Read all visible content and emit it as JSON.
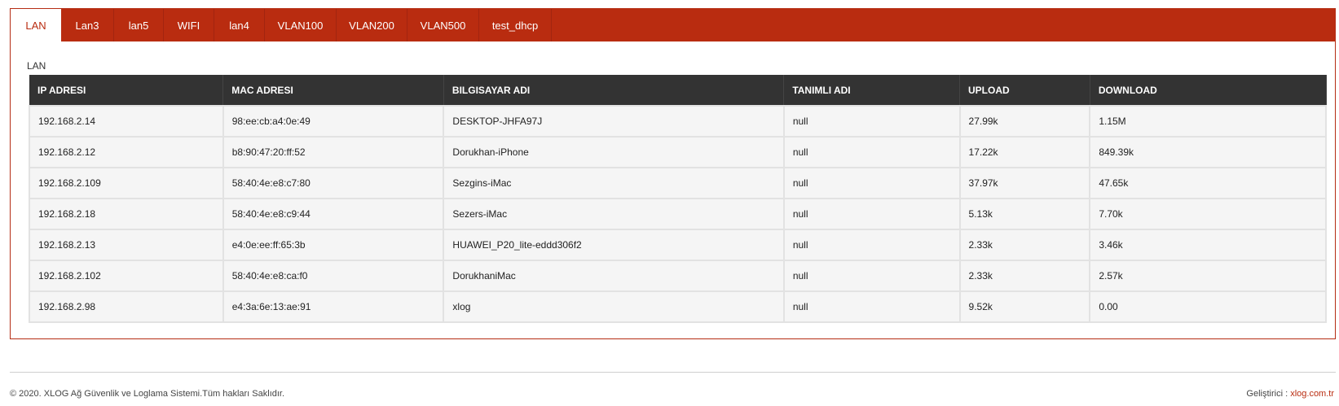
{
  "tabs": [
    {
      "label": "LAN",
      "active": true
    },
    {
      "label": "Lan3"
    },
    {
      "label": "lan5"
    },
    {
      "label": "WIFI"
    },
    {
      "label": "lan4"
    },
    {
      "label": "VLAN100"
    },
    {
      "label": "VLAN200"
    },
    {
      "label": "VLAN500"
    },
    {
      "label": "test_dhcp"
    }
  ],
  "section": {
    "label": "LAN"
  },
  "table": {
    "headers": [
      "IP ADRESI",
      "MAC ADRESI",
      "BILGISAYAR ADI",
      "TANIMLI ADI",
      "UPLOAD",
      "DOWNLOAD"
    ],
    "rows": [
      [
        "192.168.2.14",
        "98:ee:cb:a4:0e:49",
        "DESKTOP-JHFA97J",
        "null",
        "27.99k",
        "1.15M"
      ],
      [
        "192.168.2.12",
        "b8:90:47:20:ff:52",
        "Dorukhan-iPhone",
        "null",
        "17.22k",
        "849.39k"
      ],
      [
        "192.168.2.109",
        "58:40:4e:e8:c7:80",
        "Sezgins-iMac",
        "null",
        "37.97k",
        "47.65k"
      ],
      [
        "192.168.2.18",
        "58:40:4e:e8:c9:44",
        "Sezers-iMac",
        "null",
        "5.13k",
        "7.70k"
      ],
      [
        "192.168.2.13",
        "e4:0e:ee:ff:65:3b",
        "HUAWEI_P20_lite-eddd306f2",
        "null",
        "2.33k",
        "3.46k"
      ],
      [
        "192.168.2.102",
        "58:40:4e:e8:ca:f0",
        "DorukhaniMac",
        "null",
        "2.33k",
        "2.57k"
      ],
      [
        "192.168.2.98",
        "e4:3a:6e:13:ae:91",
        "xlog",
        "null",
        "9.52k",
        "0.00"
      ]
    ]
  },
  "footer": {
    "copyright": "© 2020. XLOG Ağ Güvenlik ve Loglama Sistemi.Tüm hakları Saklıdır.",
    "developer_label": "Geliştirici : ",
    "developer_link": "xlog.com.tr"
  },
  "colors": {
    "accent": "#b92c10",
    "header_bg": "#333333",
    "row_bg": "#f5f5f5"
  }
}
